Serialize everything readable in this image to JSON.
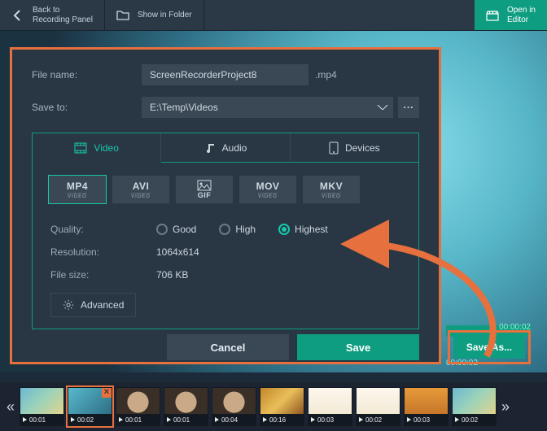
{
  "topbar": {
    "back": "Back to\nRecording Panel",
    "show_in_folder": "Show in Folder",
    "open_in_editor": "Open in\nEditor"
  },
  "dialog": {
    "file_name_label": "File name:",
    "file_name_value": "ScreenRecorderProject8",
    "file_ext": ".mp4",
    "save_to_label": "Save to:",
    "save_to_value": "E:\\Temp\\Videos",
    "browse_label": "...",
    "tabs": {
      "video": "Video",
      "audio": "Audio",
      "devices": "Devices"
    },
    "formats": [
      "MP4",
      "AVI",
      "GIF",
      "MOV",
      "MKV"
    ],
    "quality_label": "Quality:",
    "quality_options": {
      "good": "Good",
      "high": "High",
      "highest": "Highest"
    },
    "resolution_label": "Resolution:",
    "resolution_value": "1064x614",
    "file_size_label": "File size:",
    "file_size_value": "706 KB",
    "advanced": "Advanced",
    "cancel": "Cancel",
    "save": "Save"
  },
  "save_as": "Save As...",
  "time_end": "00:00:02",
  "time_mid": "00:00:02",
  "thumbs": [
    {
      "dur": "00:01"
    },
    {
      "dur": "00:02"
    },
    {
      "dur": "00:01"
    },
    {
      "dur": "00:01"
    },
    {
      "dur": "00:04"
    },
    {
      "dur": "00:16"
    },
    {
      "dur": "00:03"
    },
    {
      "dur": "00:02"
    },
    {
      "dur": "00:03"
    },
    {
      "dur": "00:02"
    }
  ]
}
